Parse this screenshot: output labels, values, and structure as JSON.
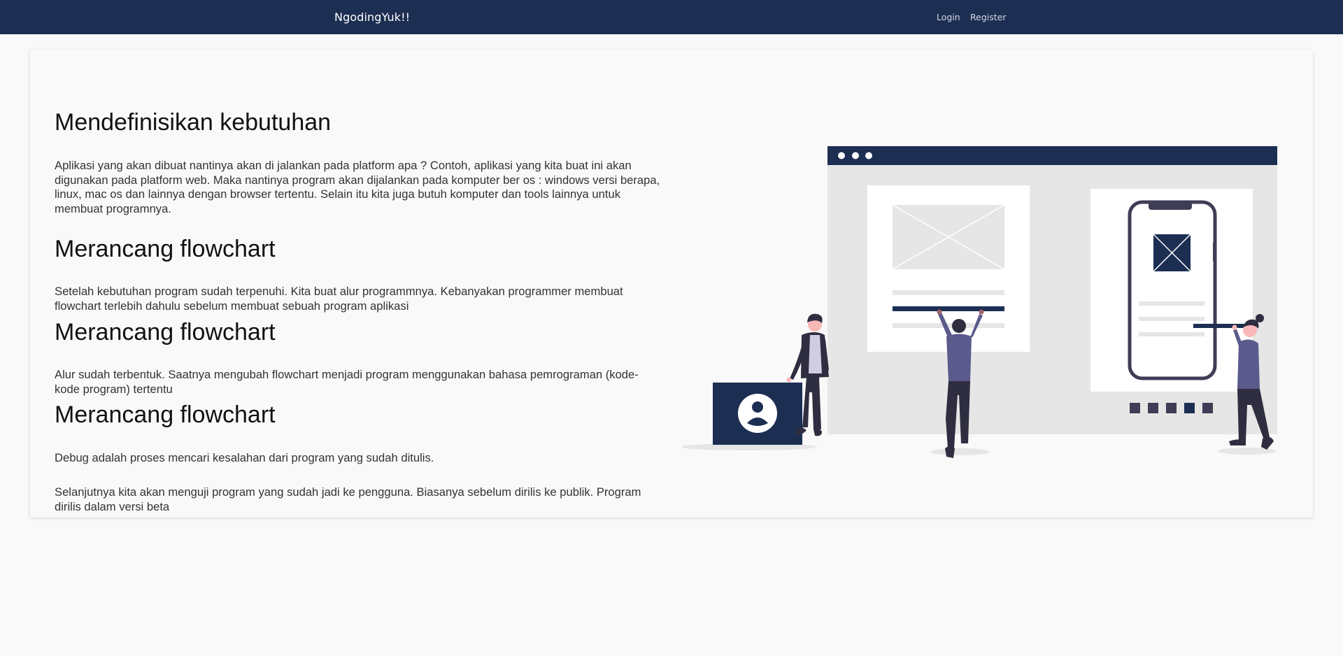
{
  "navbar": {
    "brand": "NgodingYuk!!",
    "login": "Login",
    "register": "Register",
    "background": "#1c2e52"
  },
  "sections": [
    {
      "heading": "Mendefinisikan kebutuhan",
      "text": "Aplikasi yang akan dibuat nantinya akan di jalankan pada platform apa ? Contoh, aplikasi yang kita buat ini akan digunakan pada platform web. Maka nantinya program akan dijalankan pada komputer ber os : windows versi berapa, linux, mac os dan lainnya dengan browser tertentu. Selain itu kita juga butuh komputer dan tools lainnya untuk membuat programnya."
    },
    {
      "heading": "Merancang flowchart",
      "text": "Setelah kebutuhan program sudah terpenuhi. Kita buat alur programmnya. Kebanyakan programmer membuat flowchart terlebih dahulu sebelum membuat sebuah program aplikasi"
    },
    {
      "heading": "Merancang flowchart",
      "text": "Alur sudah terbentuk. Saatnya mengubah flowchart menjadi program menggunakan bahasa pemrograman (kode-kode program) tertentu"
    },
    {
      "heading": "Merancang flowchart",
      "text": "Debug adalah proses mencari kesalahan dari program yang sudah ditulis."
    }
  ],
  "closing_text": "Selanjutnya kita akan menguji program yang sudah jadi ke pengguna. Biasanya sebelum dirilis ke publik. Program dirilis dalam versi beta",
  "colors": {
    "navy": "#1c2e52",
    "purple": "#5b5a8c",
    "dark": "#2f2e41",
    "panel_gray": "#e6e6e6",
    "white": "#ffffff"
  }
}
